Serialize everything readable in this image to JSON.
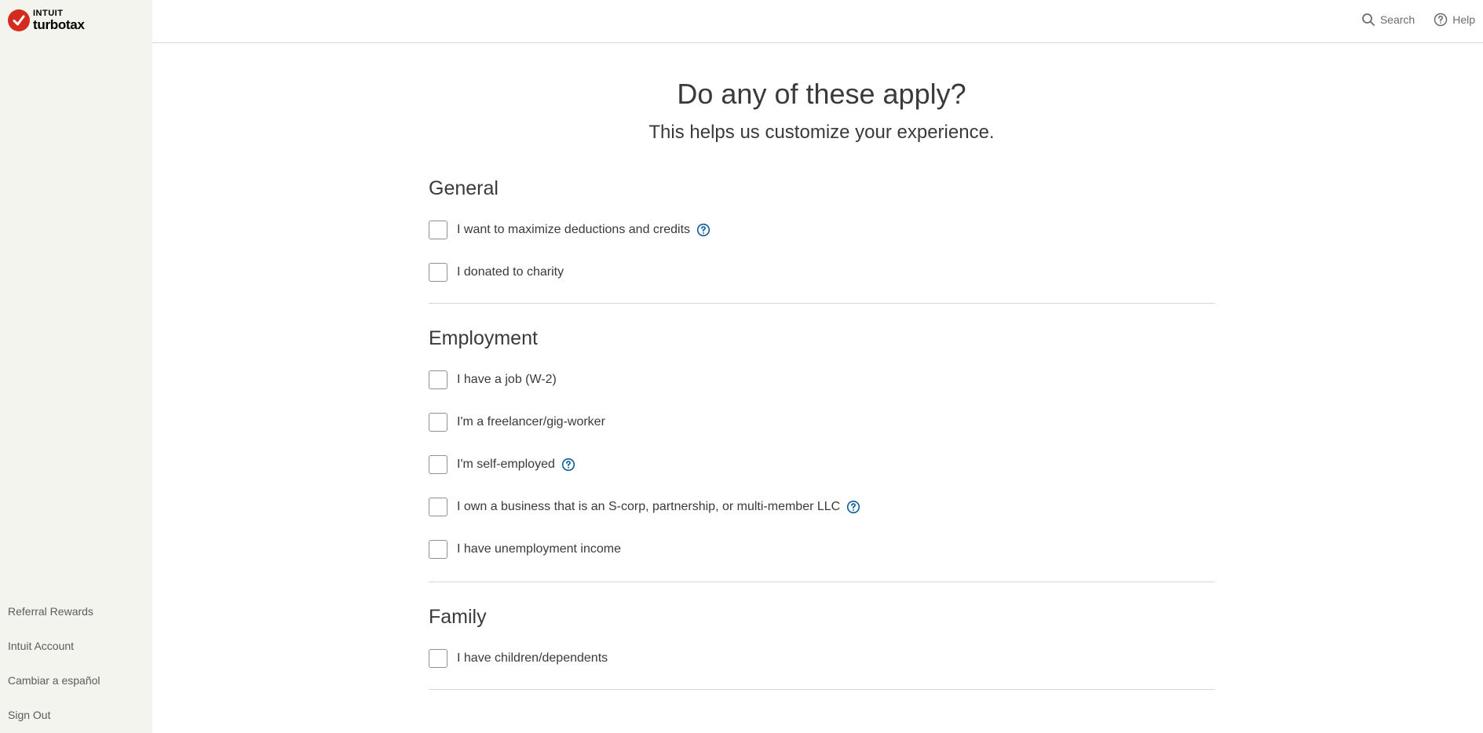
{
  "brand": {
    "company": "INTUIT",
    "product": "turbotax",
    "accent_color": "#d52b1e"
  },
  "header": {
    "search_label": "Search",
    "help_label": "Help"
  },
  "sidebar": {
    "links": [
      {
        "label": "Referral Rewards"
      },
      {
        "label": "Intuit Account"
      },
      {
        "label": "Cambiar a español"
      },
      {
        "label": "Sign Out"
      }
    ]
  },
  "main": {
    "title": "Do any of these apply?",
    "subtitle": "This helps us customize your experience.",
    "sections": [
      {
        "title": "General",
        "options": [
          {
            "label": "I want to maximize deductions and credits",
            "has_info": true,
            "checked": false
          },
          {
            "label": "I donated to charity",
            "has_info": false,
            "checked": false
          }
        ]
      },
      {
        "title": "Employment",
        "options": [
          {
            "label": "I have a job (W-2)",
            "has_info": false,
            "checked": false
          },
          {
            "label": "I'm a freelancer/gig-worker",
            "has_info": false,
            "checked": false
          },
          {
            "label": "I'm self-employed",
            "has_info": true,
            "checked": false
          },
          {
            "label": "I own a business that is an S-corp, partnership, or multi-member LLC",
            "has_info": true,
            "checked": false
          },
          {
            "label": "I have unemployment income",
            "has_info": false,
            "checked": false
          }
        ]
      },
      {
        "title": "Family",
        "options": [
          {
            "label": "I have children/dependents",
            "has_info": false,
            "checked": false
          }
        ]
      }
    ]
  },
  "icons": {
    "info": "question-circle-icon",
    "search": "search-icon",
    "help": "help-icon",
    "info_color": "#0d5c99"
  }
}
